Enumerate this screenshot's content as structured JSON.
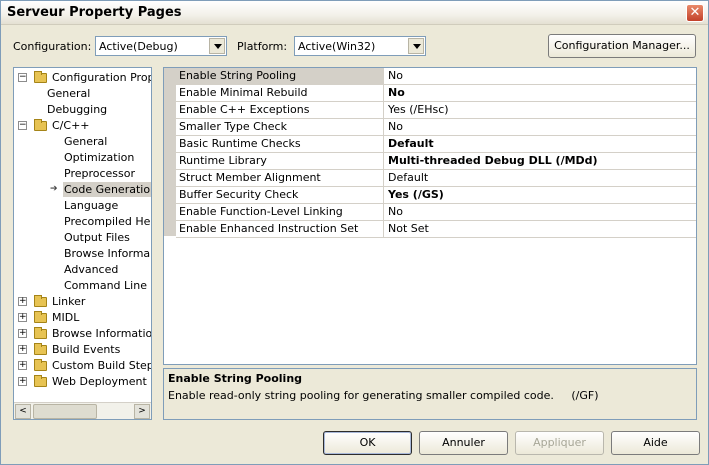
{
  "window": {
    "title": "Serveur Property Pages",
    "close_glyph": "✕"
  },
  "config": {
    "configuration_label": "Configuration:",
    "configuration_value": "Active(Debug)",
    "platform_label": "Platform:",
    "platform_value": "Active(Win32)",
    "manager_button": "Configuration Manager..."
  },
  "tree": [
    {
      "label": "Configuration Propertie",
      "expander": "−",
      "icon": "folder-icon"
    },
    {
      "label": "General"
    },
    {
      "label": "Debugging"
    },
    {
      "label": "C/C++",
      "expander": "−",
      "icon": "folder-icon"
    },
    {
      "label": "General"
    },
    {
      "label": "Optimization"
    },
    {
      "label": "Preprocessor"
    },
    {
      "label": "Code Generation",
      "selected": true
    },
    {
      "label": "Language"
    },
    {
      "label": "Precompiled Hea"
    },
    {
      "label": "Output Files"
    },
    {
      "label": "Browse Informa"
    },
    {
      "label": "Advanced"
    },
    {
      "label": "Command Line"
    },
    {
      "label": "Linker",
      "expander": "+",
      "icon": "folder-icon"
    },
    {
      "label": "MIDL",
      "expander": "+",
      "icon": "folder-icon"
    },
    {
      "label": "Browse Information",
      "expander": "+",
      "icon": "folder-icon"
    },
    {
      "label": "Build Events",
      "expander": "+",
      "icon": "folder-icon"
    },
    {
      "label": "Custom Build Step",
      "expander": "+",
      "icon": "folder-icon"
    },
    {
      "label": "Web Deployment",
      "expander": "+",
      "icon": "folder-icon"
    }
  ],
  "tree_scroll": {
    "left": "<",
    "right": ">"
  },
  "properties": [
    {
      "name": "Enable String Pooling",
      "value": "No",
      "bold": false,
      "selected": true
    },
    {
      "name": "Enable Minimal Rebuild",
      "value": "No",
      "bold": true
    },
    {
      "name": "Enable C++ Exceptions",
      "value": "Yes (/EHsc)",
      "bold": false
    },
    {
      "name": "Smaller Type Check",
      "value": "No",
      "bold": false
    },
    {
      "name": "Basic Runtime Checks",
      "value": "Default",
      "bold": true
    },
    {
      "name": "Runtime Library",
      "value": "Multi-threaded Debug DLL (/MDd)",
      "bold": true
    },
    {
      "name": "Struct Member Alignment",
      "value": "Default",
      "bold": false
    },
    {
      "name": "Buffer Security Check",
      "value": "Yes (/GS)",
      "bold": true
    },
    {
      "name": "Enable Function-Level Linking",
      "value": "No",
      "bold": false
    },
    {
      "name": "Enable Enhanced Instruction Set",
      "value": "Not Set",
      "bold": false
    }
  ],
  "description": {
    "title": "Enable String Pooling",
    "text": "Enable read-only string pooling for generating smaller compiled code.     (/GF)"
  },
  "buttons": {
    "ok": "OK",
    "cancel": "Annuler",
    "apply": "Appliquer",
    "help": "Aide"
  }
}
